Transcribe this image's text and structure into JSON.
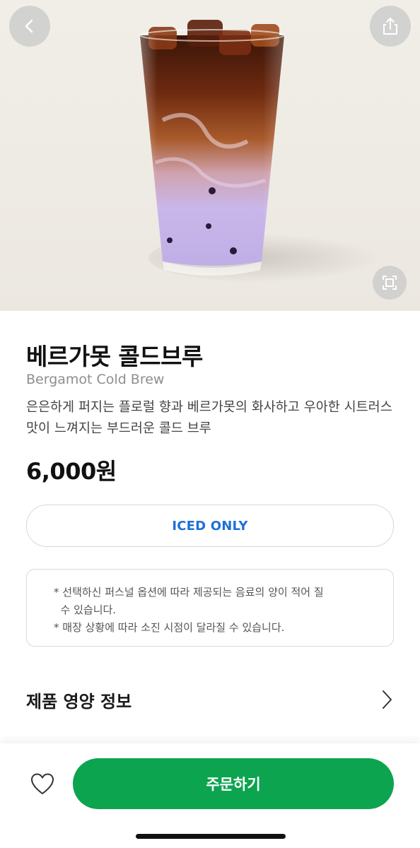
{
  "product": {
    "name_ko": "베르가못 콜드브루",
    "name_en": "Bergamot Cold Brew",
    "description": "은은하게 퍼지는 플로럴 향과 베르가못의 화사하고 우아한 시트러스 맛이 느껴지는 부드러운 콜드 브루",
    "price": "6,000원",
    "temperature_option": "ICED ONLY"
  },
  "notice": {
    "line1": "* 선택하신 퍼스널 옵션에 따라 제공되는 음료의 양이 적어 질",
    "line2": "  수 있습니다.",
    "line3": "* 매장 상황에 따라 소진 시점이 달라질 수 있습니다."
  },
  "nutrition": {
    "label": "제품 영양 정보"
  },
  "actions": {
    "order_label": "주문하기"
  },
  "icons": {
    "back": "chevron-left-icon",
    "share": "share-icon",
    "expand": "expand-icon",
    "nutrition_more": "chevron-right-icon",
    "favorite": "heart-icon"
  },
  "colors": {
    "accent_green": "#0ca44f",
    "iced_blue": "#1e6fd9",
    "hero_bg": "#efebe5"
  }
}
